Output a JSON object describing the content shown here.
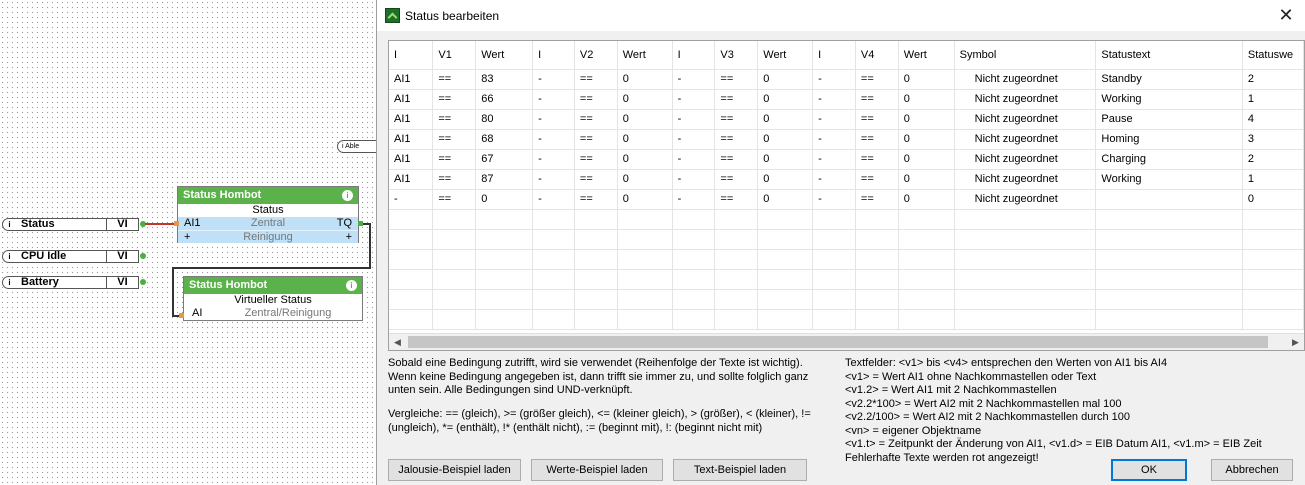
{
  "canvas": {
    "inputs": [
      {
        "label": "Status",
        "type": "VI"
      },
      {
        "label": "CPU Idle",
        "type": "VI"
      },
      {
        "label": "Battery",
        "type": "VI"
      }
    ],
    "side_pill_label": "Able",
    "block1": {
      "title": "Status Hombot",
      "subtitle": "Status",
      "port_in": "AI1",
      "center1": "Zentral",
      "port_out": "TQ",
      "plus_left": "+",
      "center2": "Reinigung",
      "plus_right": "+"
    },
    "block2": {
      "title": "Status Hombot",
      "subtitle": "Virtueller Status",
      "port_in": "AI",
      "center": "Zentral/Reinigung"
    },
    "accent_green": "#5bb24a",
    "wire_red": "#c0352e",
    "port_orange": "#e69a3c"
  },
  "dialog": {
    "title": "Status bearbeiten",
    "close_symbol": "✕",
    "columns": [
      "I",
      "V1",
      "Wert",
      "I",
      "V2",
      "Wert",
      "I",
      "V3",
      "Wert",
      "I",
      "V4",
      "Wert",
      "Symbol",
      "Statustext",
      "Statuswe"
    ],
    "rows": [
      [
        "AI1",
        "==",
        "83",
        "-",
        "==",
        "0",
        "-",
        "==",
        "0",
        "-",
        "==",
        "0",
        "Nicht zugeordnet",
        "Standby",
        "2"
      ],
      [
        "AI1",
        "==",
        "66",
        "-",
        "==",
        "0",
        "-",
        "==",
        "0",
        "-",
        "==",
        "0",
        "Nicht zugeordnet",
        "Working",
        "1"
      ],
      [
        "AI1",
        "==",
        "80",
        "-",
        "==",
        "0",
        "-",
        "==",
        "0",
        "-",
        "==",
        "0",
        "Nicht zugeordnet",
        "Pause",
        "4"
      ],
      [
        "AI1",
        "==",
        "68",
        "-",
        "==",
        "0",
        "-",
        "==",
        "0",
        "-",
        "==",
        "0",
        "Nicht zugeordnet",
        "Homing",
        "3"
      ],
      [
        "AI1",
        "==",
        "67",
        "-",
        "==",
        "0",
        "-",
        "==",
        "0",
        "-",
        "==",
        "0",
        "Nicht zugeordnet",
        "Charging",
        "2"
      ],
      [
        "AI1",
        "==",
        "87",
        "-",
        "==",
        "0",
        "-",
        "==",
        "0",
        "-",
        "==",
        "0",
        "Nicht zugeordnet",
        "Working",
        "1"
      ],
      [
        "-",
        "==",
        "0",
        "-",
        "==",
        "0",
        "-",
        "==",
        "0",
        "-",
        "==",
        "0",
        "Nicht zugeordnet",
        "",
        "0"
      ]
    ],
    "scroll_left": "◀",
    "scroll_right": "▶",
    "help_left": "Sobald eine Bedingung zutrifft, wird sie verwendet (Reihenfolge der Texte ist wichtig). Wenn keine Bedingung angegeben ist, dann trifft sie immer zu, und sollte folglich ganz unten sein. Alle Bedingungen sind UND-verknüpft.",
    "help_left2": "Vergleiche: == (gleich), >= (größer gleich), <= (kleiner gleich), > (größer), < (kleiner), != (ungleich), *= (enthält), !* (enthält nicht), := (beginnt mit), !: (beginnt nicht mit)",
    "help_right": "Textfelder: <v1> bis <v4> entsprechen den Werten von AI1 bis AI4\n<v1> = Wert AI1 ohne Nachkommastellen oder Text\n<v1.2> = Wert AI1 mit 2 Nachkommastellen\n<v2.2*100> = Wert AI2 mit 2 Nachkommastellen mal 100\n<v2.2/100> = Wert AI2 mit 2 Nachkommastellen durch 100\n<vn> = eigener Objektname\n<v1.t> = Zeitpunkt der Änderung von AI1, <v1.d> = EIB Datum AI1, <v1.m> = EIB Zeit\nFehlerhafte Texte werden rot angezeigt!",
    "buttons": {
      "jalousie": "Jalousie-Beispiel laden",
      "werte": "Werte-Beispiel laden",
      "text": "Text-Beispiel laden",
      "ok": "OK",
      "cancel": "Abbrechen"
    }
  }
}
